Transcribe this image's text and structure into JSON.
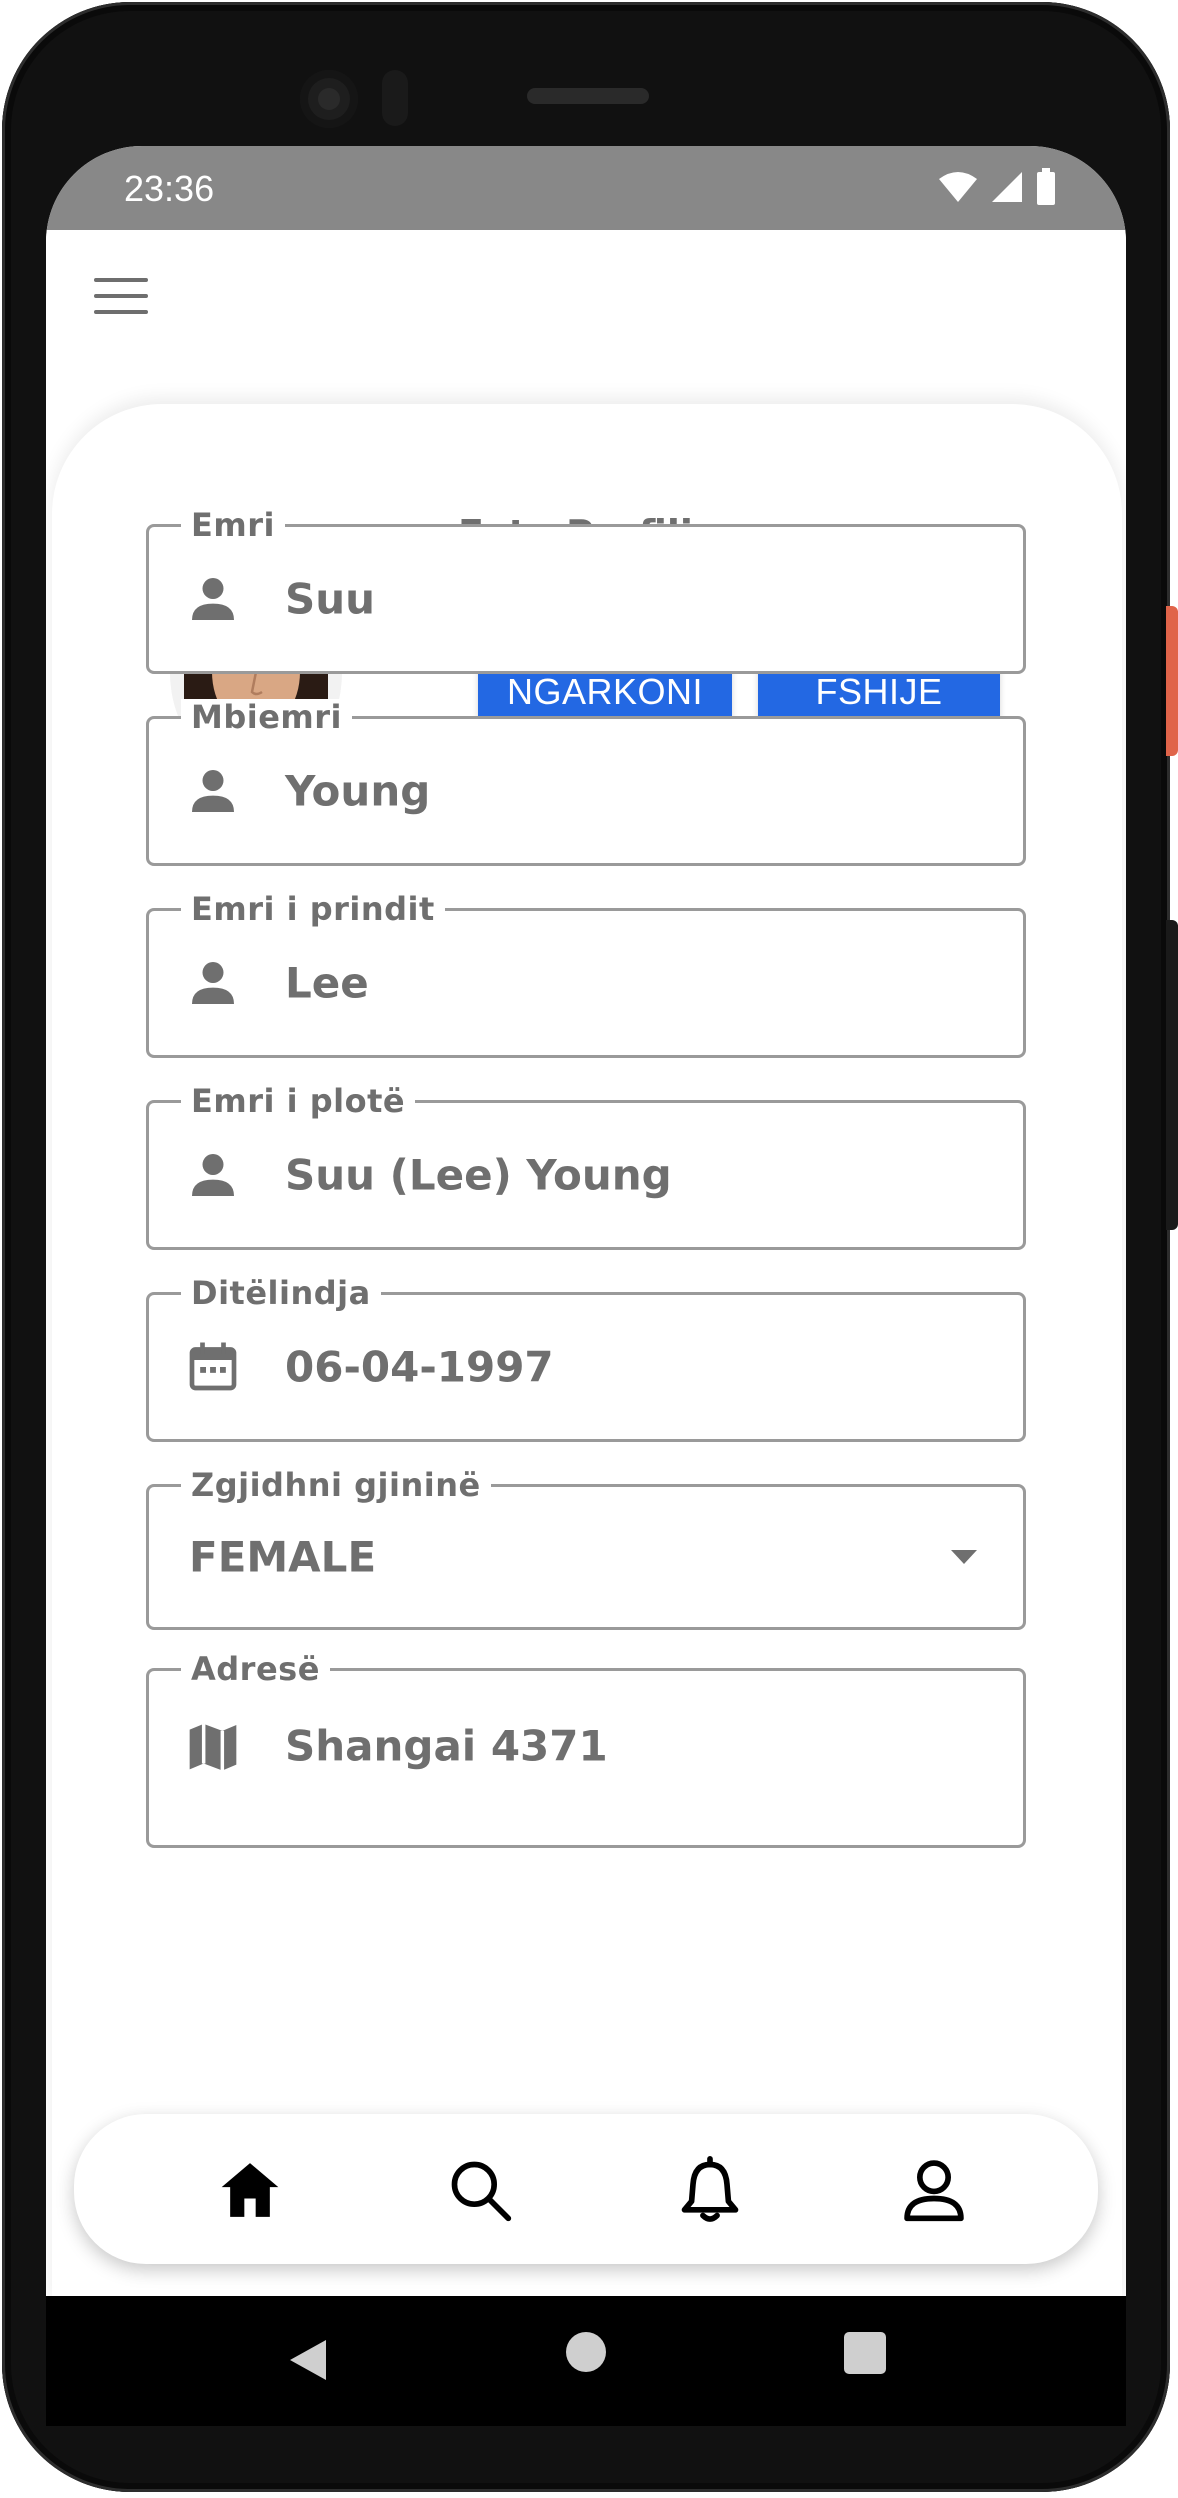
{
  "status_bar": {
    "time": "23:36",
    "icons": [
      "wifi-icon",
      "signal-icon",
      "battery-icon"
    ]
  },
  "app_bar": {
    "menu_icon": "menu-icon"
  },
  "profile": {
    "title": "Foto Profili",
    "upload_label": "NGARKONI",
    "delete_label": "FSHIJE",
    "accent_color": "#2368e3"
  },
  "fields": {
    "first_name": {
      "label": "Emri",
      "value": "Suu",
      "icon": "person-icon"
    },
    "last_name": {
      "label": "Mbiemri",
      "value": "Young",
      "icon": "person-icon"
    },
    "parent_name": {
      "label": "Emri i prindit",
      "value": "Lee",
      "icon": "person-icon"
    },
    "full_name": {
      "label": "Emri i plotë",
      "value": "Suu (Lee) Young",
      "icon": "person-icon"
    },
    "birthdate": {
      "label": "Ditëlindja",
      "value": "06-04-1997",
      "icon": "calendar-icon"
    },
    "gender": {
      "label": "Zgjidhni gjininë",
      "value": "FEMALE",
      "icon": "dropdown-arrow-icon"
    },
    "address": {
      "label": "Adresë",
      "value": "Shangai 4371",
      "icon": "map-icon"
    }
  },
  "bottom_nav": {
    "items": [
      "home-icon",
      "search-icon",
      "bell-icon",
      "profile-icon"
    ]
  },
  "system_nav": {
    "items": [
      "back-icon",
      "home-circle-icon",
      "recents-icon"
    ]
  }
}
